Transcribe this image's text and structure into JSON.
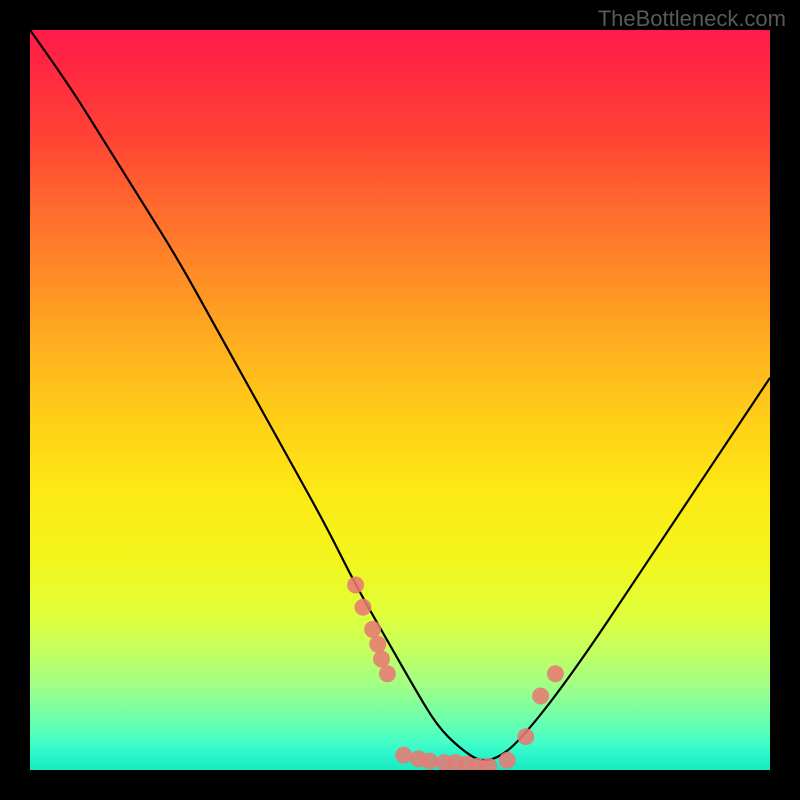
{
  "watermark": "TheBottleneck.com",
  "chart_data": {
    "type": "line",
    "title": "",
    "xlabel": "",
    "ylabel": "",
    "xlim": [
      0,
      100
    ],
    "ylim": [
      0,
      100
    ],
    "description": "Bottleneck curve over a vertical heat gradient (red=high, green=low). Curve shows high penalty at left, dips to ~0 around x=61, rises to right. Salmon markers are GPU/CPU sample points near the valley.",
    "series": [
      {
        "name": "bottleneck-curve",
        "x": [
          0,
          5,
          10,
          15,
          20,
          25,
          30,
          35,
          40,
          44,
          48,
          52,
          55,
          58,
          61,
          64,
          67,
          71,
          76,
          82,
          88,
          94,
          100
        ],
        "y": [
          100,
          93,
          85,
          77,
          69,
          60,
          51,
          42,
          33,
          25,
          18,
          11,
          6,
          3,
          1,
          2,
          5,
          10,
          17,
          26,
          35,
          44,
          53
        ]
      }
    ],
    "points": [
      {
        "x": 44.0,
        "y": 25.0
      },
      {
        "x": 45.0,
        "y": 22.0
      },
      {
        "x": 46.3,
        "y": 19.0
      },
      {
        "x": 47.0,
        "y": 17.0
      },
      {
        "x": 47.5,
        "y": 15.0
      },
      {
        "x": 48.3,
        "y": 13.0
      },
      {
        "x": 50.5,
        "y": 2.0
      },
      {
        "x": 52.5,
        "y": 1.5
      },
      {
        "x": 54.0,
        "y": 1.2
      },
      {
        "x": 56.0,
        "y": 1.0
      },
      {
        "x": 57.5,
        "y": 1.0
      },
      {
        "x": 59.0,
        "y": 0.8
      },
      {
        "x": 60.5,
        "y": 0.5
      },
      {
        "x": 62.0,
        "y": 0.5
      },
      {
        "x": 64.5,
        "y": 1.3
      },
      {
        "x": 67.0,
        "y": 4.5
      },
      {
        "x": 69.0,
        "y": 10.0
      },
      {
        "x": 71.0,
        "y": 13.0
      }
    ],
    "colors": {
      "curve": "#000000",
      "point_fill": "#e77a74",
      "background_top": "#ff1b49",
      "background_bottom": "#18e9c0"
    }
  }
}
